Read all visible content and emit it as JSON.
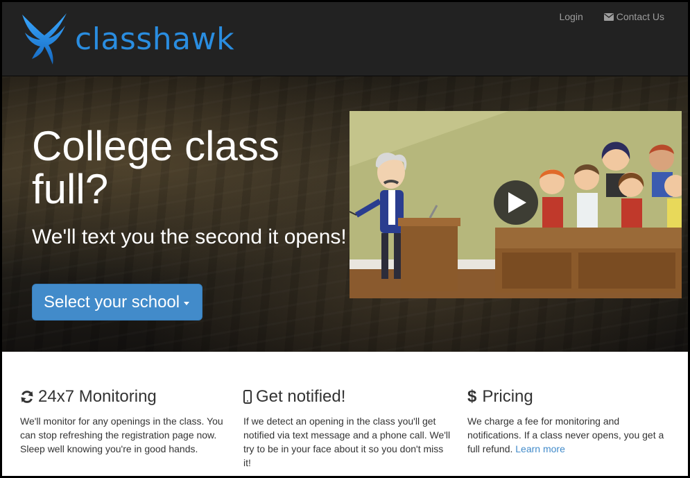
{
  "navbar": {
    "brand": "classhawk",
    "links": [
      {
        "label": "Login"
      },
      {
        "label": "Contact Us",
        "icon": "envelope-icon"
      }
    ]
  },
  "hero": {
    "title": "College class full?",
    "subtitle": "We'll text you the second it opens!",
    "cta_label": "Select your school",
    "video": {
      "icon": "play-icon"
    }
  },
  "features": [
    {
      "icon": "refresh-icon",
      "title": "24x7 Monitoring",
      "text": "We'll monitor for any openings in the class. You can stop refreshing the registration page now. Sleep well knowing you're in good hands."
    },
    {
      "icon": "mobile-phone-icon",
      "title": "Get notified!",
      "text": "If we detect an opening in the class you'll get notified via text message and a phone call. We'll try to be in your face about it so you don't miss it!"
    },
    {
      "icon": "dollar-icon",
      "title": "Pricing",
      "text": "We charge a fee for monitoring and notifications. If a class never opens, you get a full refund.",
      "link": "Learn more"
    }
  ],
  "colors": {
    "brand_blue": "#2a8de0",
    "button_blue": "#428bca",
    "navbar_bg": "#222222"
  }
}
